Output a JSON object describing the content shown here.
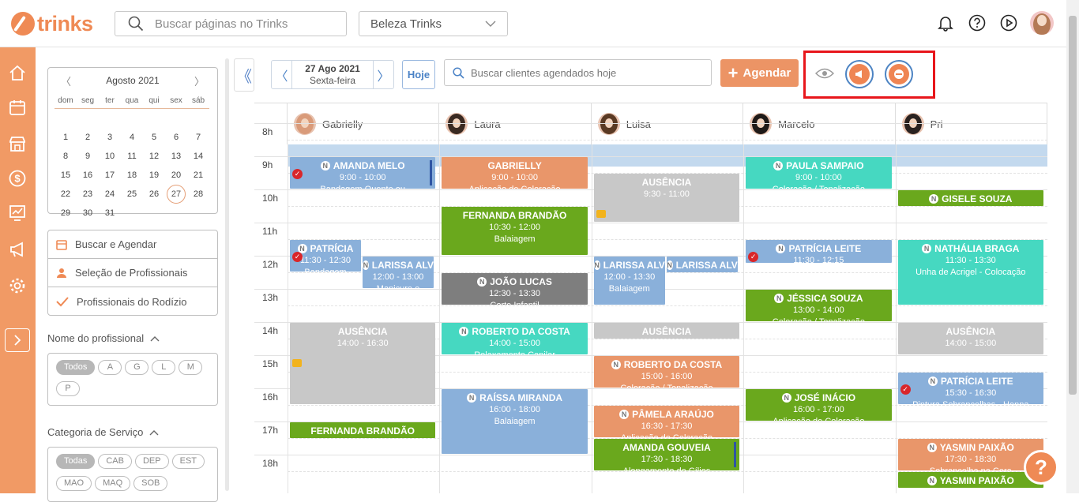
{
  "app": {
    "logo_text": "trinks",
    "search_placeholder": "Buscar páginas no Trinks",
    "business": "Beleza Trinks"
  },
  "calendar": {
    "month": "Agosto 2021",
    "dow": [
      "dom",
      "seg",
      "ter",
      "qua",
      "qui",
      "sex",
      "sáb"
    ],
    "weeks": [
      [
        "",
        "",
        "",
        "",
        "",
        "",
        ""
      ],
      [
        "1",
        "2",
        "3",
        "4",
        "5",
        "6",
        "7"
      ],
      [
        "8",
        "9",
        "10",
        "11",
        "12",
        "13",
        "14"
      ],
      [
        "15",
        "16",
        "17",
        "18",
        "19",
        "20",
        "21"
      ],
      [
        "22",
        "23",
        "24",
        "25",
        "26",
        "27",
        "28"
      ],
      [
        "29",
        "30",
        "31",
        "",
        "",
        "",
        ""
      ]
    ],
    "today": "27"
  },
  "menu": {
    "buscar": "Buscar e Agendar",
    "selecao": "Seleção de Profissionais",
    "rodizio": "Profissionais do Rodízio"
  },
  "filters": {
    "prof_title": "Nome do profissional",
    "prof_chips": [
      "Todos",
      "A",
      "G",
      "L",
      "M",
      "P"
    ],
    "cat_title": "Categoria de Serviço",
    "cat_chips": [
      "Todas",
      "CAB",
      "DEP",
      "EST",
      "MAO",
      "MAQ",
      "SOB"
    ]
  },
  "toolbar": {
    "date": "27 Ago 2021",
    "weekday": "Sexta-feira",
    "today_btn": "Hoje",
    "client_search_placeholder": "Buscar clientes agendados hoje",
    "schedule_btn": "Agendar"
  },
  "professionals": [
    "Gabrielly",
    "Laura",
    "Luisa",
    "Marcelo",
    "Pri"
  ],
  "hours": [
    "8h",
    "9h",
    "10h",
    "11h",
    "12h",
    "13h",
    "14h",
    "15h",
    "16h",
    "17h",
    "18h"
  ],
  "colors": {
    "accent": "#ef8a55",
    "blue": "#8ab0da",
    "orange": "#e9966a",
    "green": "#6aa81d",
    "teal": "#46d8c1",
    "gray": "#c8c8c8",
    "darkgray": "#7e7e7e"
  },
  "events": [
    {
      "col": 0,
      "start": "9:00",
      "end": "10:00",
      "name": "AMANDA MELO",
      "time": "9:00 - 10:00",
      "service": "Bandagem Quente ou",
      "color": "blue",
      "n": true,
      "check": true,
      "bar": true
    },
    {
      "col": 0,
      "start": "11:30",
      "end": "12:30",
      "name": "PATRÍCIA",
      "time": "11:30 - 12:30",
      "service": "Bandagem",
      "color": "blue",
      "n": true,
      "check": true,
      "w": "half"
    },
    {
      "col": 0,
      "start": "12:00",
      "end": "13:00",
      "name": "LARISSA ALV",
      "time": "12:00 - 13:00",
      "service": "Manicure e",
      "color": "blue",
      "n": true,
      "w": "half2"
    },
    {
      "col": 0,
      "start": "14:00",
      "end": "16:30",
      "name": "AUSÊNCIA",
      "time": "14:00 - 16:30",
      "service": "",
      "color": "gray",
      "msg": true
    },
    {
      "col": 0,
      "start": "17:00",
      "end": "17:30",
      "name": "FERNANDA BRANDÃO",
      "time": "",
      "service": "",
      "color": "green"
    },
    {
      "col": 1,
      "start": "9:00",
      "end": "10:00",
      "name": "GABRIELLY",
      "time": "9:00 - 10:00",
      "service": "Aplicação de Coloração",
      "color": "orange"
    },
    {
      "col": 1,
      "start": "10:30",
      "end": "12:00",
      "name": "FERNANDA BRANDÃO",
      "time": "10:30 - 12:00",
      "service": "Balaiagem",
      "color": "green"
    },
    {
      "col": 1,
      "start": "12:30",
      "end": "13:30",
      "name": "JOÃO LUCAS",
      "time": "12:30 - 13:30",
      "service": "Corte Infantil",
      "color": "dgray",
      "n": true
    },
    {
      "col": 1,
      "start": "14:00",
      "end": "15:00",
      "name": "ROBERTO DA COSTA",
      "time": "14:00 - 15:00",
      "service": "Relaxamento Capilar",
      "color": "teal",
      "n": true
    },
    {
      "col": 1,
      "start": "16:00",
      "end": "18:00",
      "name": "RAÍSSA MIRANDA",
      "time": "16:00 - 18:00",
      "service": "Balaiagem",
      "color": "blue",
      "n": true
    },
    {
      "col": 2,
      "start": "9:30",
      "end": "11:00",
      "name": "AUSÊNCIA",
      "time": "9:30 - 11:00",
      "service": "",
      "color": "gray",
      "msg": true
    },
    {
      "col": 2,
      "start": "12:00",
      "end": "13:30",
      "name": "LARISSA ALV",
      "time": "12:00 - 13:30",
      "service": "Balaiagem",
      "color": "blue",
      "n": true,
      "w": "half"
    },
    {
      "col": 2,
      "start": "12:00",
      "end": "12:15",
      "name": "LARISSA ALV",
      "time": "",
      "service": "",
      "color": "blue",
      "n": true,
      "w": "half2"
    },
    {
      "col": 2,
      "start": "14:00",
      "end": "14:30",
      "name": "AUSÊNCIA",
      "time": "",
      "service": "",
      "color": "gray",
      "msg": true
    },
    {
      "col": 2,
      "start": "15:00",
      "end": "16:00",
      "name": "ROBERTO DA COSTA",
      "time": "15:00 - 16:00",
      "service": "Coloração / Tonalização",
      "color": "orange",
      "n": true
    },
    {
      "col": 2,
      "start": "16:30",
      "end": "17:30",
      "name": "PÂMELA ARAÚJO",
      "time": "16:30 - 17:30",
      "service": "Aplicação de Coloração",
      "color": "orange",
      "n": true
    },
    {
      "col": 2,
      "start": "17:30",
      "end": "18:30",
      "name": "AMANDA GOUVEIA",
      "time": "17:30 - 18:30",
      "service": "Alongamento de Cílios",
      "color": "green",
      "bar": true
    },
    {
      "col": 3,
      "start": "9:00",
      "end": "10:00",
      "name": "PAULA SAMPAIO",
      "time": "9:00 - 10:00",
      "service": "Coloração / Tonalização",
      "color": "teal",
      "n": true
    },
    {
      "col": 3,
      "start": "11:30",
      "end": "12:15",
      "name": "PATRÍCIA LEITE",
      "time": "11:30 - 12:15",
      "service": "",
      "color": "blue",
      "n": true,
      "check": true
    },
    {
      "col": 3,
      "start": "13:00",
      "end": "14:00",
      "name": "JÉSSICA SOUZA",
      "time": "13:00 - 14:00",
      "service": "Coloração / Tonalização",
      "color": "green",
      "n": true
    },
    {
      "col": 3,
      "start": "16:00",
      "end": "17:00",
      "name": "JOSÉ INÁCIO",
      "time": "16:00 - 17:00",
      "service": "Aplicação de Coloração",
      "color": "green",
      "n": true
    },
    {
      "col": 4,
      "start": "10:00",
      "end": "10:30",
      "name": "GISELE SOUZA",
      "time": "",
      "service": "",
      "color": "green",
      "n": true
    },
    {
      "col": 4,
      "start": "11:30",
      "end": "13:30",
      "name": "NATHÁLIA BRAGA",
      "time": "11:30 - 13:30",
      "service": "Unha de Acrigel - Colocação",
      "color": "teal",
      "n": true
    },
    {
      "col": 4,
      "start": "14:00",
      "end": "15:00",
      "name": "AUSÊNCIA",
      "time": "14:00 - 15:00",
      "service": "",
      "color": "gray",
      "msg": true
    },
    {
      "col": 4,
      "start": "15:30",
      "end": "16:30",
      "name": "PATRÍCIA LEITE",
      "time": "15:30 - 16:30",
      "service": "Pintura Sobrancelhas - Henna",
      "color": "blue",
      "n": true,
      "check": true
    },
    {
      "col": 4,
      "start": "17:30",
      "end": "18:30",
      "name": "YASMIN PAIXÃO",
      "time": "17:30 - 18:30",
      "service": "Sobrancelha na Cera",
      "color": "orange",
      "n": true
    },
    {
      "col": 4,
      "start": "18:30",
      "end": "19:00",
      "name": "YASMIN PAIXÃO",
      "time": "",
      "service": "",
      "color": "green",
      "n": true
    }
  ]
}
